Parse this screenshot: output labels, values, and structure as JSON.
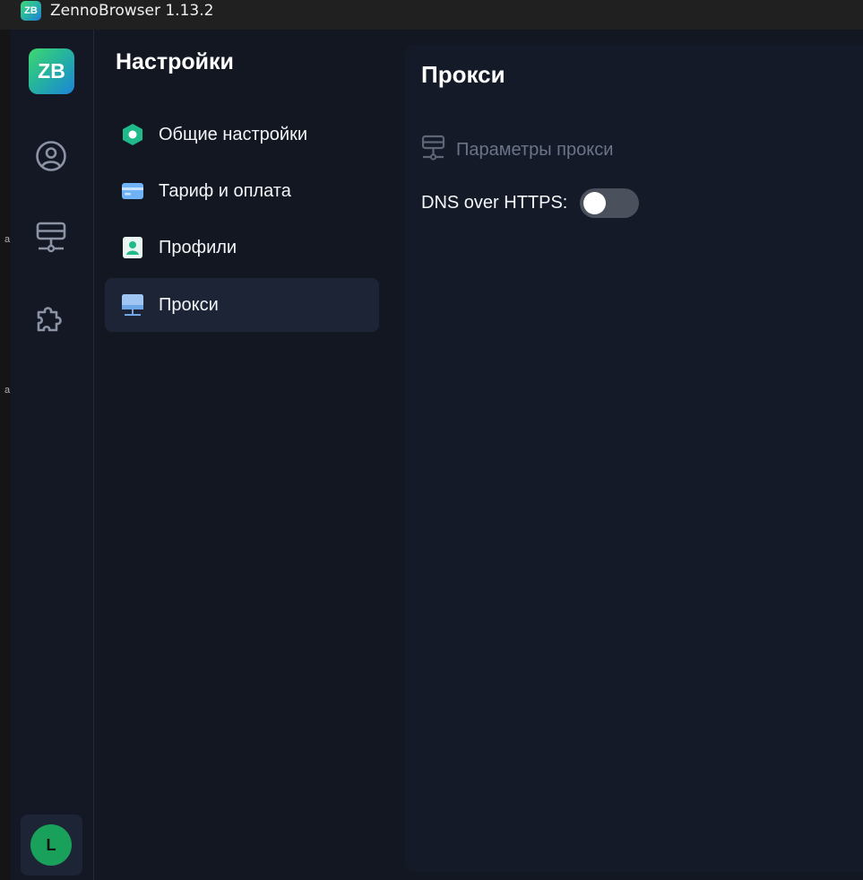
{
  "window": {
    "logo_text": "ZB",
    "title": "ZennoBrowser 1.13.2"
  },
  "rail": {
    "logo_text": "ZB",
    "icons": [
      "user-circle-icon",
      "network-icon",
      "puzzle-icon"
    ],
    "avatar_letter": "L",
    "avatar_color": "#19a15b"
  },
  "settings": {
    "title": "Настройки",
    "items": [
      {
        "label": "Общие настройки",
        "icon": "hexagon-icon"
      },
      {
        "label": "Тариф и оплата",
        "icon": "card-icon"
      },
      {
        "label": "Профили",
        "icon": "profile-icon"
      },
      {
        "label": "Прокси",
        "icon": "monitor-icon",
        "active": true
      }
    ]
  },
  "content": {
    "title": "Прокси",
    "section_label": "Параметры прокси",
    "dns_label": "DNS over HTTPS:",
    "dns_enabled": false
  },
  "colors": {
    "background": "#121722",
    "panel": "#141a27",
    "active_item": "#1c2436",
    "accent_green": "#19a15b"
  }
}
